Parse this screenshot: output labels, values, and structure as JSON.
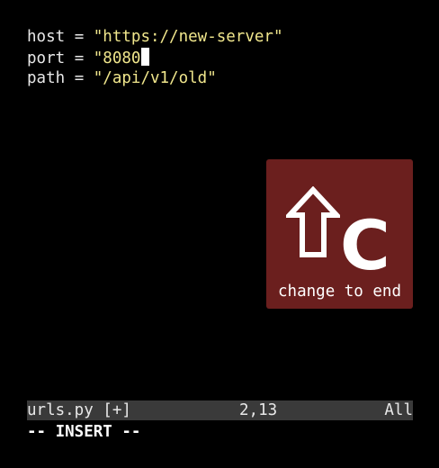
{
  "editor": {
    "lines": [
      {
        "ident": "host",
        "op": " = ",
        "str": "\"https://new-server\""
      },
      {
        "ident": "port",
        "op": " = ",
        "str": "\"8080"
      },
      {
        "ident": "path",
        "op": " = ",
        "str": "\"/api/v1/old\""
      }
    ]
  },
  "key_overlay": {
    "key": "C",
    "modifier_icon": "shift-arrow-icon",
    "caption": "change to end",
    "background": "#6b1f1e"
  },
  "statusline": {
    "filename": "urls.py [+]",
    "position": "2,13",
    "scroll": "All"
  },
  "mode": "-- INSERT --",
  "colors": {
    "string": "#f0e68c",
    "text": "#e8e8e8",
    "statusline_bg": "#3a3a3a"
  }
}
